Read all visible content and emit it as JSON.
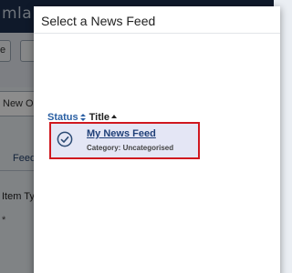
{
  "background": {
    "logo_text": "mla!",
    "header_text": "",
    "field_text": "New On th",
    "tab_label": "Feed",
    "menu_item_type_label": "Item Typ",
    "required_marker": "*"
  },
  "modal": {
    "title": "Select a News Feed",
    "columns": {
      "status": "Status",
      "title": "Title"
    },
    "rows": [
      {
        "title": "My News Feed",
        "category": "Category: Uncategorised",
        "status_icon": "published-check-icon"
      }
    ]
  },
  "colors": {
    "link_blue": "#2a5fa3",
    "highlight_red": "#d0181f",
    "row_bg": "#e4e6f5",
    "header_navy": "#1c2e4d"
  }
}
